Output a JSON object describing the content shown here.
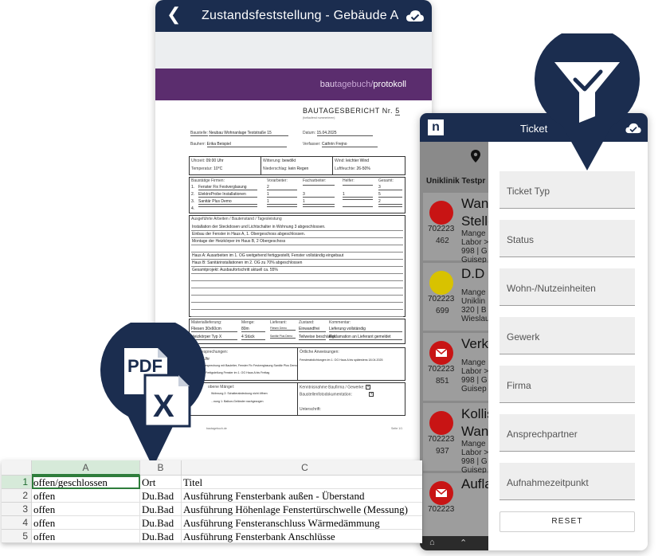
{
  "phone1": {
    "back_icon": "chevron-left-icon",
    "title": "Zustandsfeststellung - Gebäude A",
    "cloud_icon": "cloud-check-icon",
    "brand": {
      "part1": "bau",
      "part2": "tagebuch/",
      "part3": "protokoll"
    },
    "doc": {
      "title": "BAUTAGESBERICHT Nr.",
      "number": "5",
      "subtitle": "(fortlaufend nummerieren)",
      "baustelle_label": "Baustelle:",
      "baustelle": "Neubau Wohnanlage Teststraße 15",
      "datum_label": "Datum:",
      "datum": "15.04.2025",
      "bauherr_label": "Bauherr:",
      "bauherr": "Erika Beispiel",
      "verfasser_label": "Verfasser:",
      "verfasser": "Cathrin Frejno",
      "uhrzeit_label": "Uhrzeit:",
      "uhrzeit": "09:00 Uhr",
      "temperatur_label": "Temperatur:",
      "temperatur": "10°C",
      "witterung_label": "Witterung:",
      "witterung": "bewölkt",
      "niederschlag_label": "Niederschlag:",
      "niederschlag": "kein Regen",
      "wind_label": "Wind:",
      "wind": "leichter Wind",
      "luftfeuchte_label": "Luftfeuchte:",
      "luftfeuchte": "26-50%",
      "firmen_label": "Baustätige Firmen:",
      "vorarbeiter_label": "Vorarbeiter:",
      "facharbeiter_label": "Facharbeiter:",
      "helfer_label": "Helfer:",
      "gesamt_label": "Gesamt:",
      "firmen": [
        {
          "nr": "1.",
          "name": "Fenster Fix Festverglasung",
          "v": "2",
          "f": "",
          "h": "",
          "g": "3"
        },
        {
          "nr": "2.",
          "name": "ElektroProbe Installationen",
          "v": "1",
          "f": "3",
          "h": "1",
          "g": "5"
        },
        {
          "nr": "3.",
          "name": "Sanitär Plus Demo",
          "v": "1",
          "f": "1",
          "h": "",
          "g": "2"
        },
        {
          "nr": "4.",
          "name": "",
          "v": "",
          "f": "",
          "h": "",
          "g": ""
        }
      ],
      "arbeiten_label": "Ausgeführte Arbeiten / Bautenstand / Tagesleistung",
      "arbeiten": [
        "Installation der Steckdosen und Lichtschalter in Wohnung 3 abgeschlossen.",
        "Einbau der Fenster in Haus A, 1. Obergeschoss abgeschlossen.",
        "Montage der Heizkörper im Haus B, 2 Obergeschoss",
        "",
        "Haus A: Ausarbeiten im 1. OG weitgehend fertiggestellt, Fenster vollständig eingebaut",
        "Haus B: Sanitärinstallationen im 2. OG zu 70% abgeschlossen",
        "Gesamtprojekt: Ausbaufortschritt aktuell ca. 55%"
      ],
      "material_label": "Materiallieferung:",
      "menge_label": "Menge:",
      "lieferant_label": "Lieferant:",
      "zustand_label": "Zustand:",
      "kommentar_label": "Kommentar:",
      "material": [
        {
          "m": "Fliesen 30x60cm",
          "q": "80m",
          "l": "Fliesen Demo",
          "z": "Einwandfrei",
          "k": "Lieferung vollständig"
        },
        {
          "m": "Heizkörper Typ X",
          "q": "4 Stück",
          "l": "Sanitär Plus Demo",
          "z": "Teilweise beschädigt",
          "k": "Reklamation an Lieferant gemeldet"
        }
      ],
      "besprechungen_label": "esprechungen:",
      "besprechungen_uhr": "Uhr",
      "besprechungen": [
        "Besprechung mit Bauleiter, Fenster Fix Festverglasung Sanitär Plus Demo",
        "...Fertigstellung Fenster im 1. OG Haus A bis Freitag"
      ],
      "anweisungen_label": "Örtliche Anweisungen:",
      "anweisungen": "Fensterabdichtungen im 1. OG Haus A bis spätestens 18.04.2025",
      "maengel_label": "obene Mängel:",
      "maengel": [
        "Wohnung 2: Schalterabdeckung nicht öffnen",
        "...nung 1: Balkon-Geländer nachgezogen"
      ],
      "kenntnis_label": "Kenntnisnahme Baufirma / Gewerke:",
      "fotodoku_label": "Baustellenfotodokumentation:",
      "unterschrift_label": "Unterschrift:",
      "footer_left": "bautagebuch.de",
      "footer_right": "Seite 1/1"
    }
  },
  "pins": {
    "filter_icon": "filter-check-icon",
    "export_icon": "pdf-excel-export-icon",
    "pdf_label": "PDF",
    "x_label": "X"
  },
  "phone2": {
    "logo_letter": "n",
    "title": "Ticket",
    "cloud_icon": "cloud-check-icon",
    "location_icon": "location-pin-icon",
    "project": "Uniklinik Testpr",
    "colors": {
      "red": "#c81414",
      "yellow": "#d8c200",
      "navy": "#1b2d4f"
    },
    "tickets": [
      {
        "status": "red-dot",
        "big": "Wand",
        "big2": "Stelle",
        "id1": "702223",
        "id2": "462",
        "lines": [
          "Mange",
          "Labor >",
          "998 | G",
          "Guisep"
        ]
      },
      {
        "status": "yellow-dot",
        "big": "D.D u",
        "big2": "",
        "id1": "702223",
        "id2": "699",
        "lines": [
          "Mange",
          "Uniklin",
          "320 | B",
          "Wieslau"
        ]
      },
      {
        "status": "red-mail",
        "big": "Verkl",
        "big2": "",
        "id1": "702223",
        "id2": "851",
        "lines": [
          "Mange",
          "Labor >",
          "998 | G",
          "Guisep"
        ]
      },
      {
        "status": "red-dot",
        "big": "Kollis",
        "big2": "Wand",
        "id1": "702223",
        "id2": "937",
        "lines": [
          "Mange",
          "Labor >",
          "998 | G",
          "Guisep"
        ]
      },
      {
        "status": "red-mail",
        "big": "Aufla",
        "big2": "",
        "id1": "702223",
        "id2": "",
        "lines": []
      }
    ],
    "filters": [
      {
        "label": "Ticket Typ"
      },
      {
        "label": "Status"
      },
      {
        "label": "Wohn-/Nutzeinheiten"
      },
      {
        "label": "Gewerk"
      },
      {
        "label": "Firma"
      },
      {
        "label": "Ansprechpartner"
      },
      {
        "label": "Aufnahmezeitpunkt"
      }
    ],
    "reset_label": "RESET",
    "nav_home_icon": "home-icon",
    "nav_up_icon": "chevron-up-icon"
  },
  "sheet": {
    "columns": [
      "A",
      "B",
      "C"
    ],
    "rows": [
      {
        "n": "1",
        "a": "offen/geschlossen",
        "b": "Ort",
        "c": "Titel"
      },
      {
        "n": "2",
        "a": "offen",
        "b": "Du.Bad",
        "c": "Ausführung Fensterbank außen - Überstand"
      },
      {
        "n": "3",
        "a": "offen",
        "b": "Du.Bad",
        "c": "Ausführung Höhenlage Fenstertürschwelle (Messung)"
      },
      {
        "n": "4",
        "a": "offen",
        "b": "Du.Bad",
        "c": "Ausführung Fensteranschluss Wärmedämmung"
      },
      {
        "n": "5",
        "a": "offen",
        "b": "Du.Bad",
        "c": "Ausführung Fensterbank Anschlüsse"
      }
    ]
  }
}
